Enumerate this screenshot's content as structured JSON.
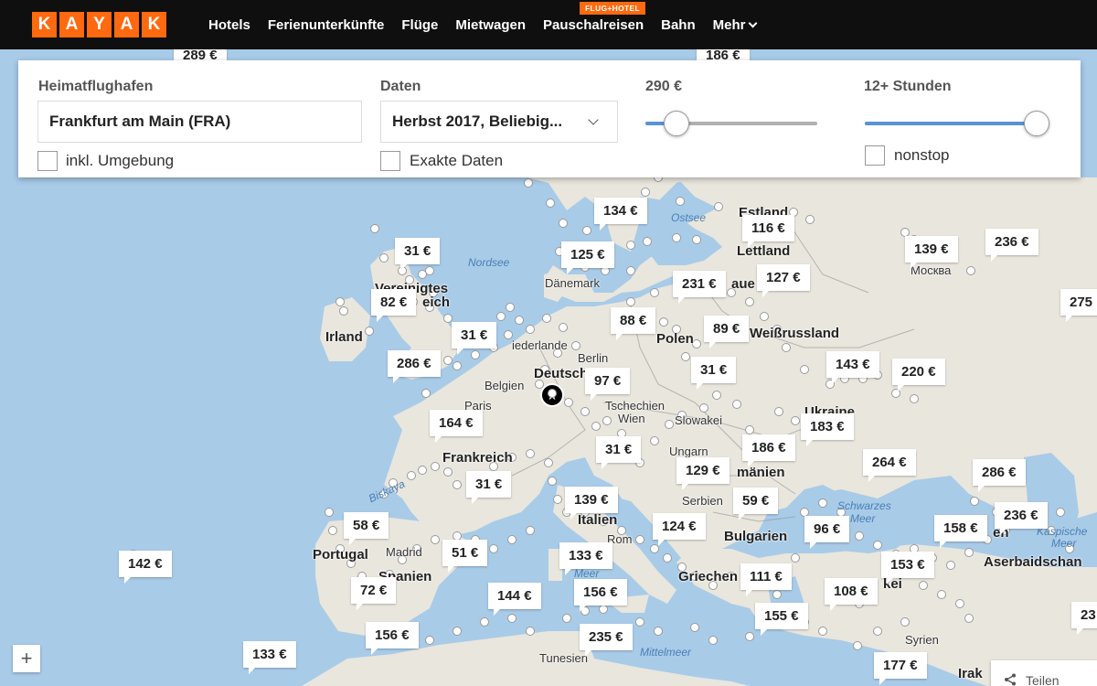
{
  "nav": {
    "logo": [
      "K",
      "A",
      "Y",
      "A",
      "K"
    ],
    "items": [
      "Hotels",
      "Ferienunterkünfte",
      "Flüge",
      "Mietwagen",
      "Pauschalreisen",
      "Bahn",
      "Mehr"
    ],
    "badge": "FLUG+HOTEL",
    "accent": "#ff690f"
  },
  "search": {
    "origin_label": "Heimatflughafen",
    "origin_value": "Frankfurt am Main (FRA)",
    "nearby_label": "inkl. Umgebung",
    "dates_label": "Daten",
    "dates_value": "Herbst 2017, Beliebig...",
    "exact_label": "Exakte Daten",
    "price_label": "290 €",
    "price_fraction": 0.18,
    "duration_label": "12+ Stunden",
    "duration_fraction": 1.0,
    "nonstop_label": "nonstop",
    "slider_color": "#5a92d8"
  },
  "prices": [
    "289 €",
    "186 €",
    "134 €",
    "116 €",
    "31 €",
    "125 €",
    "139 €",
    "236 €",
    "127 €",
    "231 €",
    "82 €",
    "88 €",
    "275",
    "31 €",
    "89 €",
    "286 €",
    "97 €",
    "31 €",
    "143 €",
    "220 €",
    "164 €",
    "183 €",
    "31 €",
    "186 €",
    "264 €",
    "129 €",
    "286 €",
    "31 €",
    "139 €",
    "59 €",
    "236 €",
    "58 €",
    "124 €",
    "96 €",
    "158 €",
    "51 €",
    "133 €",
    "153 €",
    "142 €",
    "111 €",
    "72 €",
    "144 €",
    "156 €",
    "108 €",
    "156 €",
    "235 €",
    "155 €",
    "133 €",
    "177 €",
    "23"
  ],
  "labels": {
    "ostsee": "Ostsee",
    "estland": "Estland",
    "lettland": "Lettland",
    "nordsee": "Nordsee",
    "daenemark": "Dänemark",
    "moskau_de": "Mo",
    "moskau_ru": "Москва",
    "vk1": "Vereinigtes",
    "vk2": "eich",
    "irland": "Irland",
    "auen": "aue",
    "polen": "Polen",
    "weiss": "Weißrussland",
    "niederlande": "iederlande",
    "berlin": "Berlin",
    "deutschland": "Deutsch",
    "belgien": "Belgien",
    "paris": "Paris",
    "tschechien": "Tschechien",
    "wien": "Wien",
    "slowakei": "Slowakei",
    "ukraine": "Ukraine",
    "ungarn": "Ungarn",
    "frankreich": "Frankreich",
    "rumaenien": "mänien",
    "biskaya": "Biskaya",
    "serbien": "Serbien",
    "italien": "Italien",
    "schwarzes": "Schwarzes",
    "meer": "Meer",
    "en": "en",
    "kaspische": "Kaspische",
    "kaspische2": "Meer",
    "portugal": "Portugal",
    "madrid": "Madrid",
    "spanien": "Spanien",
    "rom": "Rom",
    "bulgarien": "Bulgarien",
    "tyrr": "Meer",
    "griechen": "Griechen",
    "kei": "kei",
    "aserbaidschan": "Aserbaidschan",
    "syrien": "Syrien",
    "irak": "Irak",
    "tunesien": "Tunesien",
    "mittelmeer": "Mittelmeer"
  },
  "controls": {
    "zoom_in": "+",
    "share": "Teilen"
  },
  "colors": {
    "land": "#e9e6dd",
    "sea": "#a8cbe8",
    "home_marker": "#000000"
  }
}
